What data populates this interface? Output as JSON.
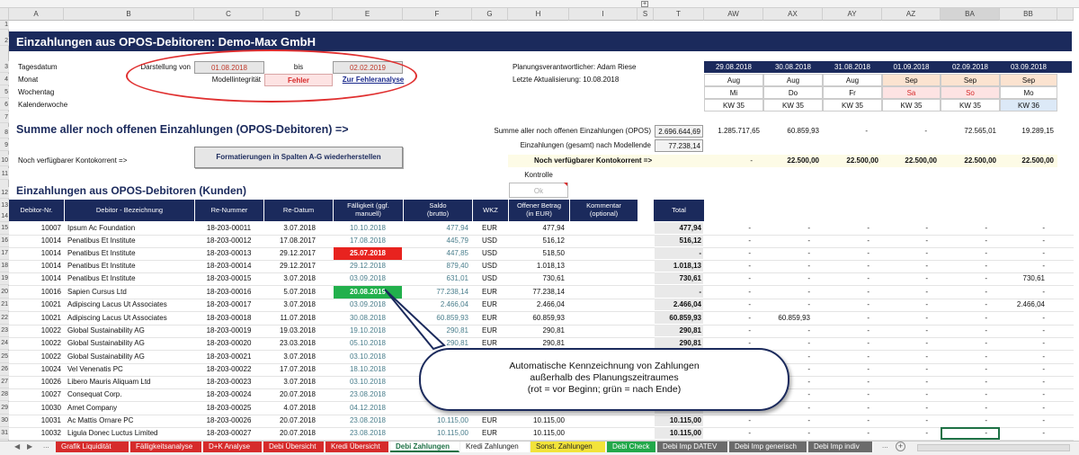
{
  "columns": [
    "A",
    "B",
    "C",
    "D",
    "E",
    "F",
    "G",
    "H",
    "I",
    "S",
    "T",
    "AW",
    "AX",
    "AY",
    "AZ",
    "BA",
    "BB"
  ],
  "row_numbers": [
    "1",
    "2",
    "3",
    "4",
    "5",
    "6",
    "7",
    "8",
    "9",
    "10",
    "11",
    "12",
    "13",
    "14",
    "15",
    "16",
    "17",
    "18",
    "19",
    "20",
    "21",
    "22",
    "23",
    "24",
    "25",
    "26",
    "27",
    "28",
    "29",
    "30",
    "31"
  ],
  "title": "Einzahlungen aus OPOS-Debitoren: Demo-Max GmbH",
  "info": {
    "tagesdatum": "Tagesdatum",
    "monat": "Monat",
    "wochentag": "Wochentag",
    "kalenderwoche": "Kalenderwoche",
    "darstellung_von": "Darstellung von",
    "date_from": "01.08.2018",
    "bis": "bis",
    "date_to": "02.02.2019",
    "modellintegritaet": "Modellintegrität",
    "fehler": "Fehler",
    "fehleranalyse": "Zur Fehleranalyse",
    "planungsverantwortlicher": "Planungsverantwortlicher: Adam Riese",
    "letzte_aktualisierung": "Letzte Aktualisierung: 10.08.2018"
  },
  "calendar": {
    "dates": [
      "29.08.2018",
      "30.08.2018",
      "31.08.2018",
      "01.09.2018",
      "02.09.2018",
      "03.09.2018"
    ],
    "months": [
      "Aug",
      "Aug",
      "Aug",
      "Sep",
      "Sep",
      "Sep"
    ],
    "weekdays": [
      "Mi",
      "Do",
      "Fr",
      "Sa",
      "So",
      "Mo"
    ],
    "weeks": [
      "KW 35",
      "KW 35",
      "KW 35",
      "KW 35",
      "KW 35",
      "KW 36"
    ]
  },
  "summary": {
    "heading": "Summe aller noch offenen Einzahlungen (OPOS-Debitoren) =>",
    "label1": "Summe aller noch offenen Einzahlungen (OPOS)",
    "value1": "2.696.644,69",
    "label2": "Einzahlungen (gesamt) nach Modellende",
    "value2": "77.238,14",
    "daily": [
      "1.285.717,65",
      "60.859,93",
      "-",
      "-",
      "72.565,01",
      "19.289,15"
    ],
    "kontokorrent_label": "Noch verfügbarer Kontokorrent =>",
    "format_button": "Formatierungen in Spalten A-G wiederherstellen",
    "kontokorrent_label2": "Noch verfügbarer Kontokorrent =>",
    "kontokorrent_first": "-",
    "kontokorrent_values": [
      "22.500,00",
      "22.500,00",
      "22.500,00",
      "22.500,00",
      "22.500,00"
    ],
    "kontrolle": "Kontrolle",
    "ok": "Ok"
  },
  "section_heading": "Einzahlungen aus OPOS-Debitoren (Kunden)",
  "table_headers": [
    "Debitor-Nr.",
    "Debitor - Bezeichnung",
    "Re-Nummer",
    "Re-Datum",
    "Fälligkeit (ggf. manuell)",
    "Saldo (brutto)",
    "WKZ",
    "Offener Betrag (in EUR)",
    "Kommentar (optional)",
    "Total"
  ],
  "rows": [
    {
      "nr": "10007",
      "name": "Ipsum Ac Foundation",
      "re": "18-203-00011",
      "datum": "3.07.2018",
      "faellig": "10.10.2018",
      "saldo": "477,94",
      "wkz": "EUR",
      "offen": "477,94",
      "total": "477,94",
      "days": [
        "-",
        "-",
        "-",
        "-",
        "-",
        "-"
      ]
    },
    {
      "nr": "10014",
      "name": "Penatibus Et Institute",
      "re": "18-203-00012",
      "datum": "17.08.2017",
      "faellig": "17.08.2018",
      "saldo": "445,79",
      "wkz": "USD",
      "offen": "516,12",
      "total": "516,12",
      "days": [
        "-",
        "-",
        "-",
        "-",
        "-",
        "-"
      ]
    },
    {
      "nr": "10014",
      "name": "Penatibus Et Institute",
      "re": "18-203-00013",
      "datum": "29.12.2017",
      "faellig": "25.07.2018",
      "saldo": "447,85",
      "wkz": "USD",
      "offen": "518,50",
      "total": "-",
      "days": [
        "-",
        "-",
        "-",
        "-",
        "-",
        "-"
      ]
    },
    {
      "nr": "10014",
      "name": "Penatibus Et Institute",
      "re": "18-203-00014",
      "datum": "29.12.2017",
      "faellig": "29.12.2018",
      "saldo": "879,40",
      "wkz": "USD",
      "offen": "1.018,13",
      "total": "1.018,13",
      "days": [
        "-",
        "-",
        "-",
        "-",
        "-",
        "-"
      ]
    },
    {
      "nr": "10014",
      "name": "Penatibus Et Institute",
      "re": "18-203-00015",
      "datum": "3.07.2018",
      "faellig": "03.09.2018",
      "saldo": "631,01",
      "wkz": "USD",
      "offen": "730,61",
      "total": "730,61",
      "days": [
        "-",
        "-",
        "-",
        "-",
        "-",
        "730,61"
      ]
    },
    {
      "nr": "10016",
      "name": "Sapien Cursus Ltd",
      "re": "18-203-00016",
      "datum": "5.07.2018",
      "faellig": "20.08.2019",
      "saldo": "77.238,14",
      "wkz": "EUR",
      "offen": "77.238,14",
      "total": "-",
      "days": [
        "-",
        "-",
        "-",
        "-",
        "-",
        "-"
      ]
    },
    {
      "nr": "10021",
      "name": "Adipiscing Lacus Ut Associates",
      "re": "18-203-00017",
      "datum": "3.07.2018",
      "faellig": "03.09.2018",
      "saldo": "2.466,04",
      "wkz": "EUR",
      "offen": "2.466,04",
      "total": "2.466,04",
      "days": [
        "-",
        "-",
        "-",
        "-",
        "-",
        "2.466,04"
      ]
    },
    {
      "nr": "10021",
      "name": "Adipiscing Lacus Ut Associates",
      "re": "18-203-00018",
      "datum": "11.07.2018",
      "faellig": "30.08.2018",
      "saldo": "60.859,93",
      "wkz": "EUR",
      "offen": "60.859,93",
      "total": "60.859,93",
      "days": [
        "-",
        "60.859,93",
        "-",
        "-",
        "-",
        "-"
      ]
    },
    {
      "nr": "10022",
      "name": "Global Sustainability AG",
      "re": "18-203-00019",
      "datum": "19.03.2018",
      "faellig": "19.10.2018",
      "saldo": "290,81",
      "wkz": "EUR",
      "offen": "290,81",
      "total": "290,81",
      "days": [
        "-",
        "-",
        "-",
        "-",
        "-",
        "-"
      ]
    },
    {
      "nr": "10022",
      "name": "Global Sustainability AG",
      "re": "18-203-00020",
      "datum": "23.03.2018",
      "faellig": "05.10.2018",
      "saldo": "290,81",
      "wkz": "EUR",
      "offen": "290,81",
      "total": "290,81",
      "days": [
        "-",
        "-",
        "-",
        "-",
        "-",
        "-"
      ]
    },
    {
      "nr": "10022",
      "name": "Global Sustainability AG",
      "re": "18-203-00021",
      "datum": "3.07.2018",
      "faellig": "03.10.2018",
      "saldo": "",
      "wkz": "",
      "offen": "",
      "total": "",
      "days": [
        "-",
        "-",
        "-",
        "-",
        "-",
        "-"
      ]
    },
    {
      "nr": "10024",
      "name": "Vel Venenatis PC",
      "re": "18-203-00022",
      "datum": "17.07.2018",
      "faellig": "18.10.2018",
      "saldo": "",
      "wkz": "",
      "offen": "",
      "total": "",
      "days": [
        "-",
        "-",
        "-",
        "-",
        "-",
        "-"
      ]
    },
    {
      "nr": "10026",
      "name": "Libero Mauris Aliquam Ltd",
      "re": "18-203-00023",
      "datum": "3.07.2018",
      "faellig": "03.10.2018",
      "saldo": "",
      "wkz": "",
      "offen": "",
      "total": "",
      "days": [
        "-",
        "-",
        "-",
        "-",
        "-",
        "-"
      ]
    },
    {
      "nr": "10027",
      "name": "Consequat Corp.",
      "re": "18-203-00024",
      "datum": "20.07.2018",
      "faellig": "23.08.2018",
      "saldo": "",
      "wkz": "",
      "offen": "",
      "total": "",
      "days": [
        "-",
        "-",
        "-",
        "-",
        "-",
        "-"
      ]
    },
    {
      "nr": "10030",
      "name": "Amet Company",
      "re": "18-203-00025",
      "datum": "4.07.2018",
      "faellig": "04.12.2018",
      "saldo": "",
      "wkz": "EUR",
      "offen": "",
      "total": "",
      "days": [
        "-",
        "-",
        "-",
        "-",
        "-",
        "-"
      ]
    },
    {
      "nr": "10031",
      "name": "Ac Mattis Ornare PC",
      "re": "18-203-00026",
      "datum": "20.07.2018",
      "faellig": "23.08.2018",
      "saldo": "10.115,00",
      "wkz": "EUR",
      "offen": "10.115,00",
      "total": "10.115,00",
      "days": [
        "-",
        "-",
        "-",
        "-",
        "-",
        "-"
      ]
    },
    {
      "nr": "10032",
      "name": "Ligula Donec Luctus Limited",
      "re": "18-203-00027",
      "datum": "20.07.2018",
      "faellig": "23.08.2018",
      "saldo": "10.115,00",
      "wkz": "EUR",
      "offen": "10.115,00",
      "total": "10.115,00",
      "days": [
        "-",
        "-",
        "-",
        "-",
        "-",
        "-"
      ]
    }
  ],
  "callout": {
    "line1": "Automatische Kennzeichnung von Zahlungen",
    "line2": "außerhalb des Planungszeitraumes",
    "line3": "(rot = vor Beginn; grün = nach Ende)"
  },
  "tabs": [
    {
      "label": "Grafik Liquidität",
      "color": "#d62b2b"
    },
    {
      "label": "Fälligkeitsanalyse",
      "color": "#d62b2b"
    },
    {
      "label": "D+K Analyse",
      "color": "#d62b2b"
    },
    {
      "label": "Debi Übersicht",
      "color": "#d62b2b"
    },
    {
      "label": "Kredi Übersicht",
      "color": "#d62b2b"
    },
    {
      "label": "Debi Zahlungen",
      "color": "#ffffff",
      "active": true
    },
    {
      "label": "Kredi Zahlungen",
      "color": "#ffffff"
    },
    {
      "label": "Sonst. Zahlungen",
      "color": "#f2e33a"
    },
    {
      "label": "Debi Check",
      "color": "#22a84a"
    },
    {
      "label": "Debi Imp DATEV",
      "color": "#6b6b6b"
    },
    {
      "label": "Debi Imp generisch",
      "color": "#6b6b6b"
    },
    {
      "label": "Debi Imp indiv",
      "color": "#6b6b6b"
    }
  ],
  "tab_more": "..."
}
